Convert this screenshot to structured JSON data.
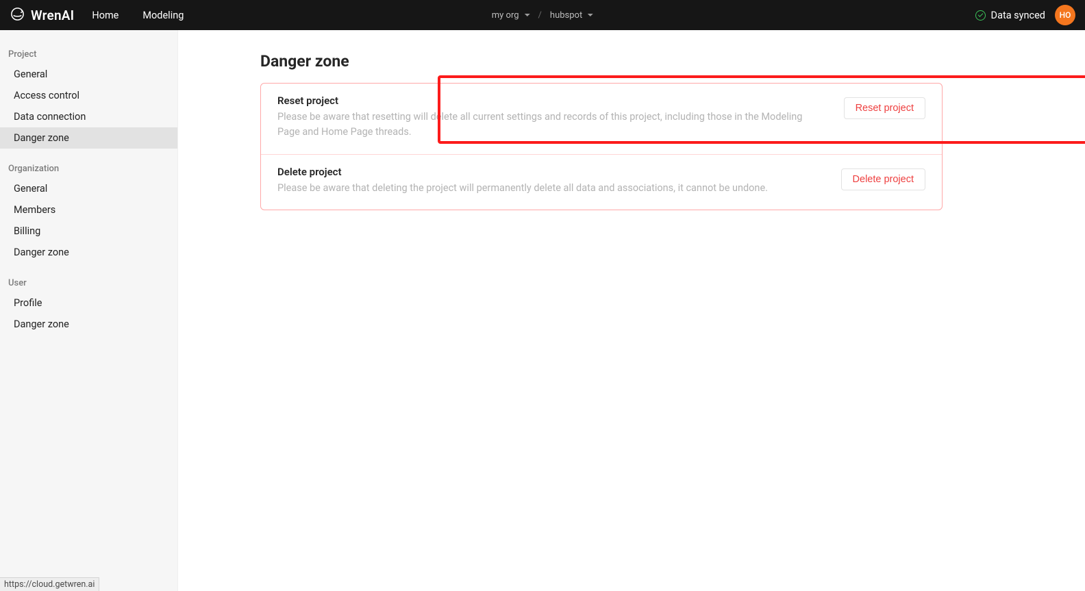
{
  "header": {
    "brand": "WrenAI",
    "nav": {
      "home": "Home",
      "modeling": "Modeling"
    },
    "breadcrumb": {
      "org": "my org",
      "project": "hubspot"
    },
    "sync_status": "Data synced",
    "avatar_initials": "HO"
  },
  "sidebar": {
    "groups": [
      {
        "title": "Project",
        "items": [
          "General",
          "Access control",
          "Data connection",
          "Danger zone"
        ],
        "activeIndex": 3
      },
      {
        "title": "Organization",
        "items": [
          "General",
          "Members",
          "Billing",
          "Danger zone"
        ],
        "activeIndex": -1
      },
      {
        "title": "User",
        "items": [
          "Profile",
          "Danger zone"
        ],
        "activeIndex": -1
      }
    ]
  },
  "page": {
    "title": "Danger zone",
    "sections": [
      {
        "title": "Reset project",
        "desc": "Please be aware that resetting will delete all current settings and records of this project, including those in the Modeling Page and Home Page threads.",
        "button": "Reset project"
      },
      {
        "title": "Delete project",
        "desc": "Please be aware that deleting the project will permanently delete all data and associations, it cannot be undone.",
        "button": "Delete project"
      }
    ]
  },
  "status_url": "https://cloud.getwren.ai"
}
